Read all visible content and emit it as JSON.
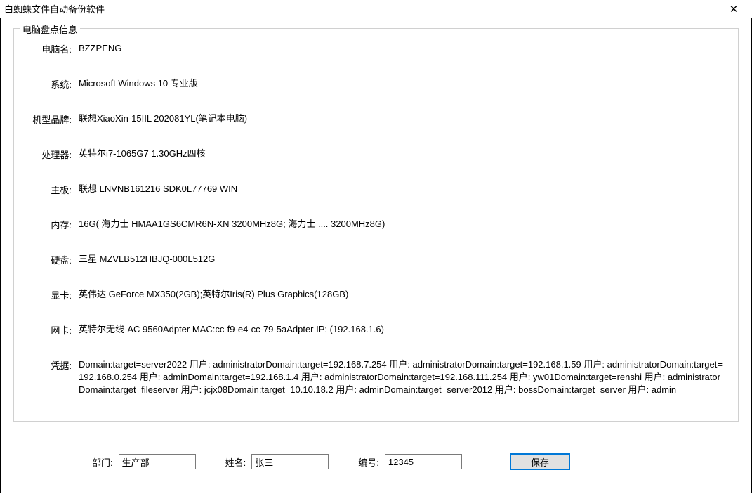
{
  "window": {
    "title": "白蜘蛛文件自动备份软件"
  },
  "group": {
    "legend": "电脑盘点信息",
    "rows": {
      "computer_name": {
        "label": "电脑名:",
        "value": "BZZPENG"
      },
      "system": {
        "label": "系统:",
        "value": "Microsoft Windows 10 专业版"
      },
      "model": {
        "label": "机型品牌:",
        "value": "联想XiaoXin-15IIL 202081YL(笔记本电脑)"
      },
      "cpu": {
        "label": "处理器:",
        "value": "英特尔i7-1065G7 1.30GHz四核"
      },
      "mainboard": {
        "label": "主板:",
        "value": "联想 LNVNB161216 SDK0L77769 WIN"
      },
      "memory": {
        "label": "内存:",
        "value": "16G( 海力士 HMAA1GS6CMR6N-XN 3200MHz8G; 海力士 .... 3200MHz8G)"
      },
      "disk": {
        "label": "硬盘:",
        "value": "三星 MZVLB512HBJQ-000L512G"
      },
      "gpu": {
        "label": "显卡:",
        "value": "英伟达 GeForce MX350(2GB);英特尔Iris(R) Plus Graphics(128GB)"
      },
      "nic": {
        "label": "网卡:",
        "value": "英特尔无线-AC 9560Adpter MAC:cc-f9-e4-cc-79-5aAdpter IP: (192.168.1.6)"
      },
      "credentials": {
        "label": "凭据:",
        "value": "Domain:target=server2022 用户: administratorDomain:target=192.168.7.254 用户: administratorDomain:target=192.168.1.59 用户: administratorDomain:target=192.168.0.254 用户: adminDomain:target=192.168.1.4 用户: administratorDomain:target=192.168.111.254 用户: yw01Domain:target=renshi 用户: administratorDomain:target=fileserver 用户: jcjx08Domain:target=10.10.18.2 用户: adminDomain:target=server2012 用户: bossDomain:target=server 用户: admin"
      }
    }
  },
  "form": {
    "dept_label": "部门:",
    "dept_value": "生产部",
    "name_label": "姓名:",
    "name_value": "张三",
    "id_label": "编号:",
    "id_value": "12345",
    "save_label": "保存"
  }
}
